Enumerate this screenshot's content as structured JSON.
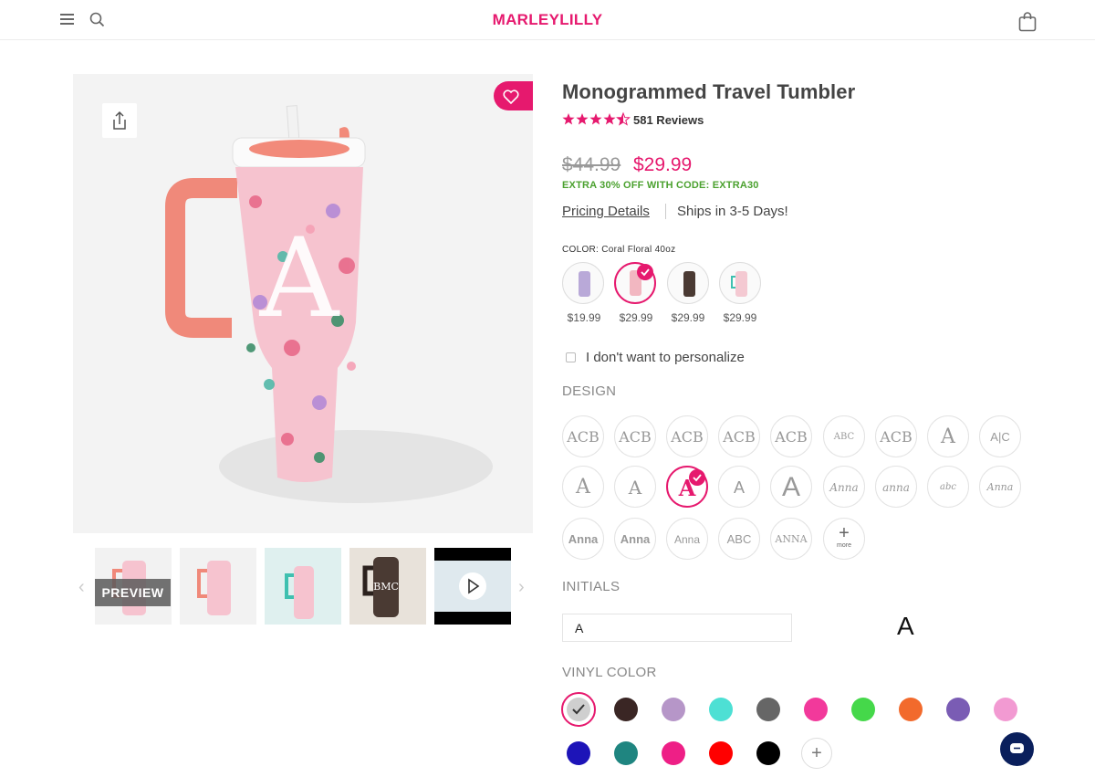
{
  "header": {
    "logo": "MARLEYLILLY",
    "icons": [
      "menu-icon",
      "search-icon",
      "bag-icon"
    ]
  },
  "gallery": {
    "preview_label": "PREVIEW",
    "thumbnails": [
      "thumb-1",
      "thumb-2",
      "thumb-3",
      "thumb-4",
      "thumb-video"
    ],
    "main_monogram": "A",
    "thumb4_monogram": "BMC"
  },
  "product": {
    "title": "Monogrammed Travel Tumbler",
    "rating": 4.5,
    "reviews": "581 Reviews",
    "price_old": "$44.99",
    "price_new": "$29.99",
    "promo": "EXTRA 30% OFF WITH CODE: EXTRA30",
    "pricing_link": "Pricing Details",
    "shipping": "Ships in 3-5 Days!"
  },
  "color": {
    "label": "COLOR: Coral Floral 40oz",
    "options": [
      {
        "price": "$19.99",
        "tone": "#b9a9d8",
        "selected": false
      },
      {
        "price": "$29.99",
        "tone": "#f2b7c1",
        "selected": true
      },
      {
        "price": "$29.99",
        "tone": "#4a3a33",
        "selected": false
      },
      {
        "price": "$29.99",
        "tone": "#7fcfc4",
        "selected": false
      }
    ]
  },
  "personalize": {
    "opt_out_label": "I don't want to personalize"
  },
  "design": {
    "heading": "DESIGN",
    "row1": [
      "ACB",
      "ACB",
      "ACB",
      "ACB",
      "ACB",
      "ABC",
      "ACB",
      "A",
      "A|C"
    ],
    "row2": [
      "A",
      "A",
      "A",
      "A",
      "A",
      "Anna",
      "anna",
      "abc",
      "Anna"
    ],
    "row3": [
      "Anna",
      "Anna",
      "Anna",
      "ABC",
      "ANNA"
    ],
    "more_label": "more",
    "selected_index": 2
  },
  "initials": {
    "heading": "INITIALS",
    "value": "A",
    "preview": "A"
  },
  "vinyl": {
    "heading": "VINYL COLOR",
    "row1": [
      "#cfcfcf",
      "#3a2624",
      "#b696c8",
      "#4de0d4",
      "#666666",
      "#f2399b",
      "#45d84a",
      "#f26a2c",
      "#7a5cb4",
      "#f29ad2"
    ],
    "row2": [
      "#1d14b8",
      "#1f8580",
      "#ee1f86",
      "#ff0000",
      "#000000"
    ],
    "more_label": "+"
  }
}
